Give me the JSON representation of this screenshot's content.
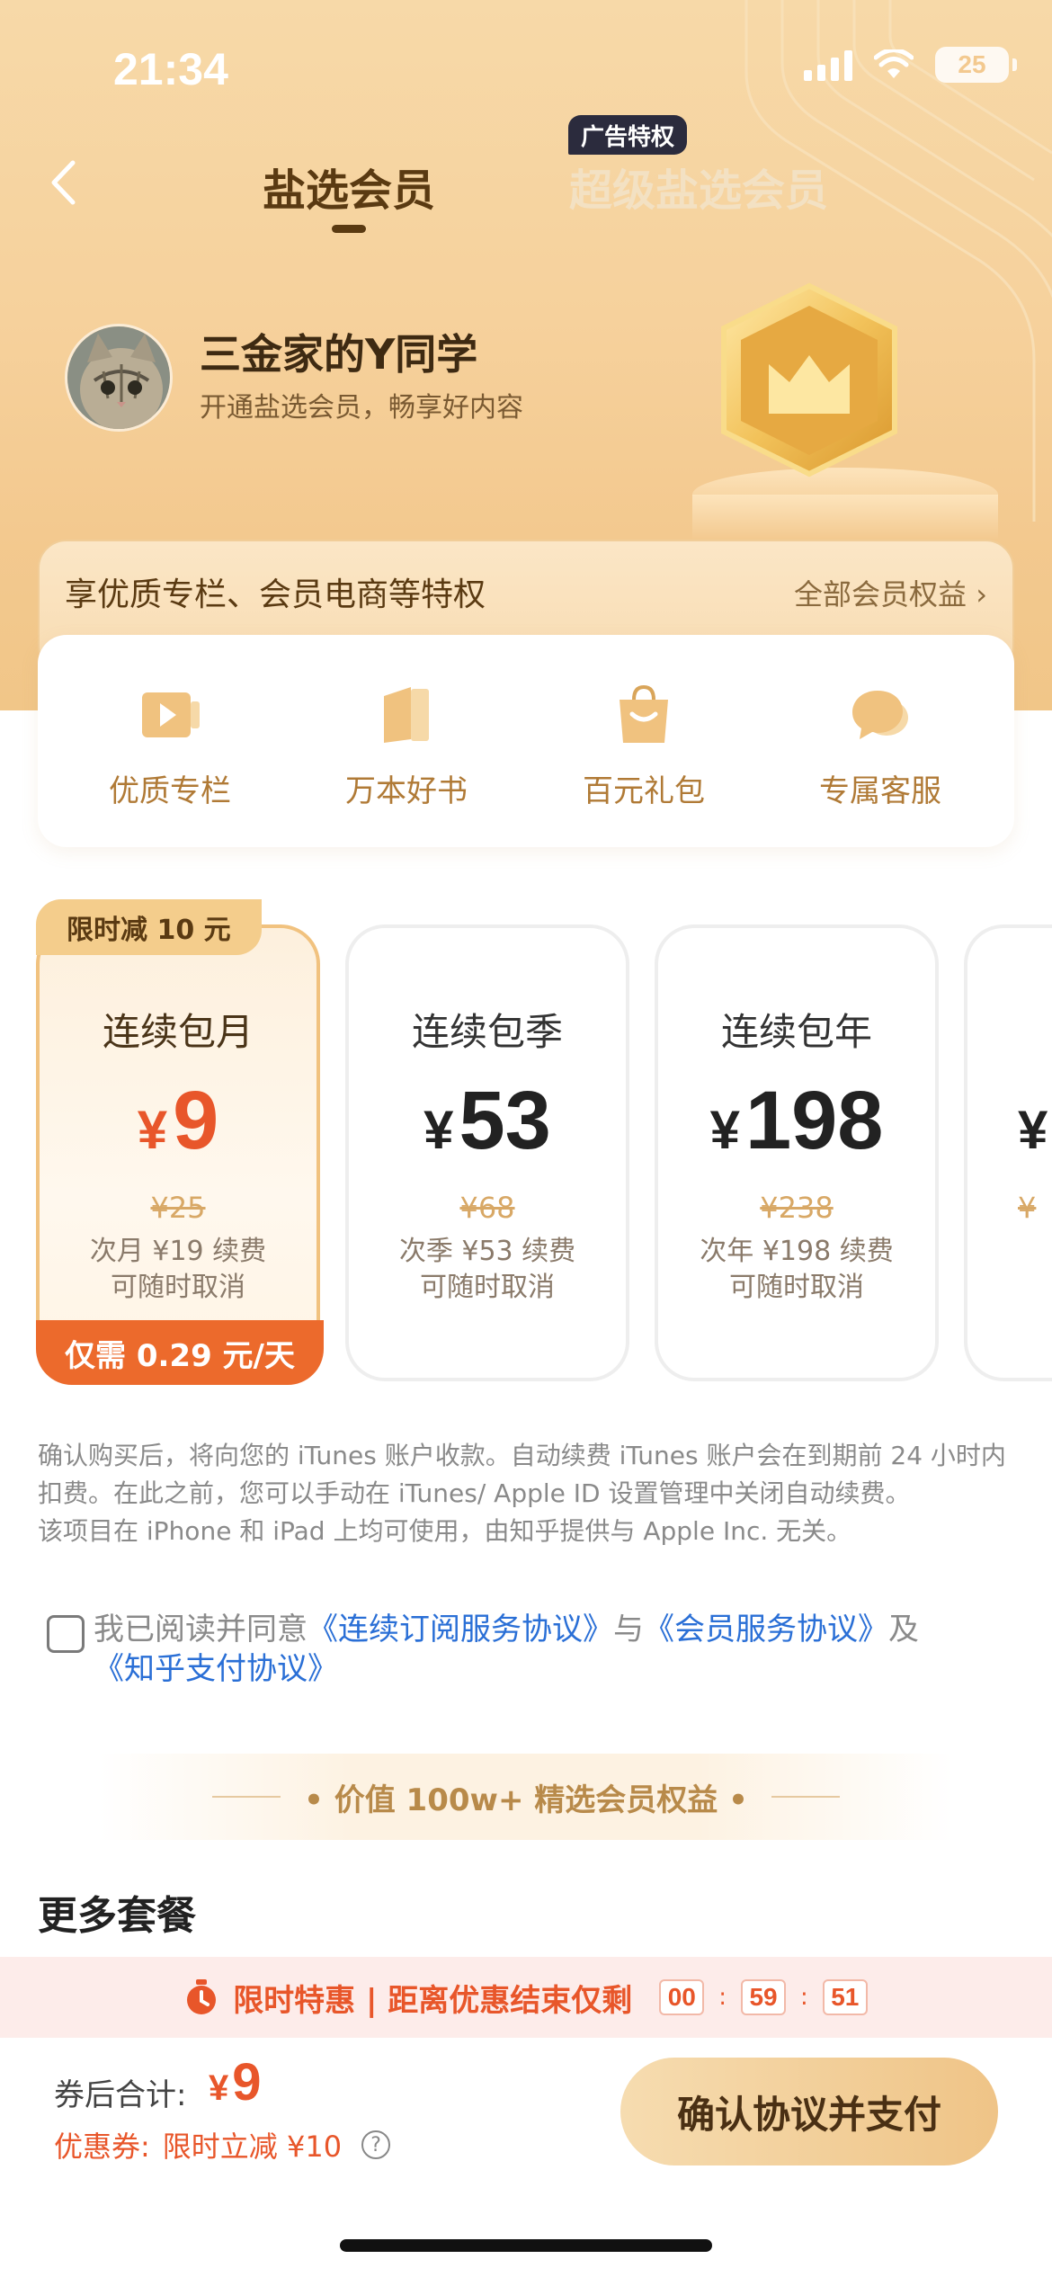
{
  "status_bar": {
    "time": "21:34",
    "battery": "25"
  },
  "nav": {
    "tabs": [
      {
        "label": "盐选会员"
      },
      {
        "label": "超级盐选会员"
      }
    ],
    "ad_badge": "广告特权"
  },
  "user": {
    "name": "三金家的Y同学",
    "subtitle": "开通盐选会员，畅享好内容"
  },
  "benefits": {
    "title": "享优质专栏、会员电商等特权",
    "all_label": "全部会员权益 ›",
    "items": [
      {
        "label": "优质专栏",
        "icon": "video-icon"
      },
      {
        "label": "万本好书",
        "icon": "book-icon"
      },
      {
        "label": "百元礼包",
        "icon": "gift-bag-icon"
      },
      {
        "label": "专属客服",
        "icon": "chat-icon"
      }
    ]
  },
  "plans": {
    "tag": "限时减 10 元",
    "daily": "仅需 0.29 元/天",
    "items": [
      {
        "name": "连续包月",
        "currency": "¥",
        "price": "9",
        "original": "¥25",
        "renew": "次月 ¥19 续费",
        "cancel": "可随时取消"
      },
      {
        "name": "连续包季",
        "currency": "¥",
        "price": "53",
        "original": "¥68",
        "renew": "次季 ¥53 续费",
        "cancel": "可随时取消"
      },
      {
        "name": "连续包年",
        "currency": "¥",
        "price": "198",
        "original": "¥238",
        "renew": "次年 ¥198 续费",
        "cancel": "可随时取消"
      },
      {
        "name": "",
        "currency": "¥",
        "price": "",
        "original": "¥",
        "renew": "",
        "cancel": ""
      }
    ]
  },
  "legal": {
    "line1": "确认购买后，将向您的 iTunes 账户收款。自动续费 iTunes 账户会在到期前 24 小时内扣费。在此之前，您可以手动在 iTunes/ Apple ID 设置管理中关闭自动续费。",
    "line2": "该项目在 iPhone 和 iPad 上均可使用，由知乎提供与 Apple Inc. 无关。"
  },
  "agreement": {
    "prefix": "我已阅读并同意",
    "link1": "《连续订阅服务协议》",
    "and1": "与",
    "link2": "《会员服务协议》",
    "and2": "及",
    "link3": "《知乎支付协议》"
  },
  "value_banner": "• 价值 100w+ 精选会员权益 •",
  "more_title": "更多套餐",
  "countdown": {
    "label": "限时特惠 | 距离优惠结束仅剩",
    "hours": "00",
    "minutes": "59",
    "seconds": "51"
  },
  "pay": {
    "total_label": "券后合计:",
    "currency": "¥",
    "total": "9",
    "coupon_label": "优惠券:",
    "coupon_value": "限时立减 ¥10",
    "button": "确认协议并支付"
  },
  "colors": {
    "accent": "#e8562a",
    "gold": "#f1c27f",
    "link": "#2a6fd6"
  }
}
